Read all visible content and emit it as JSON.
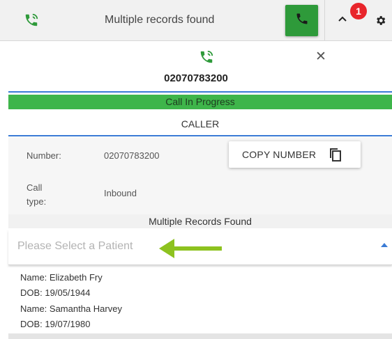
{
  "header": {
    "title": "Multiple records found",
    "notification_count": "1"
  },
  "call": {
    "number": "02070783200",
    "status": "Call In Progress",
    "section": "CALLER"
  },
  "details": {
    "number_label": "Number:",
    "number_value": "02070783200",
    "call_type_label_line1": "Call",
    "call_type_label_line2": "type:",
    "call_type_value": "Inbound",
    "copy_button": "COPY NUMBER"
  },
  "records": {
    "heading": "Multiple Records Found",
    "select_placeholder": "Please Select a Patient",
    "patients": [
      {
        "name": "Name: Elizabeth Fry",
        "dob": "DOB: 19/05/1944"
      },
      {
        "name": "Name: Samantha Harvey",
        "dob": "DOB: 19/07/1980"
      }
    ]
  },
  "colors": {
    "accent_green": "#2e9a3a",
    "status_green": "#3eb54a",
    "annotation_arrow": "#8dc21f",
    "badge_red": "#e8252b",
    "line_blue": "#3a7bd5"
  },
  "icons": [
    "phone-ringing-icon",
    "phone-icon",
    "chevron-up-icon",
    "gear-icon",
    "close-icon",
    "copy-icon",
    "caret-up-icon",
    "arrow-left-icon"
  ]
}
